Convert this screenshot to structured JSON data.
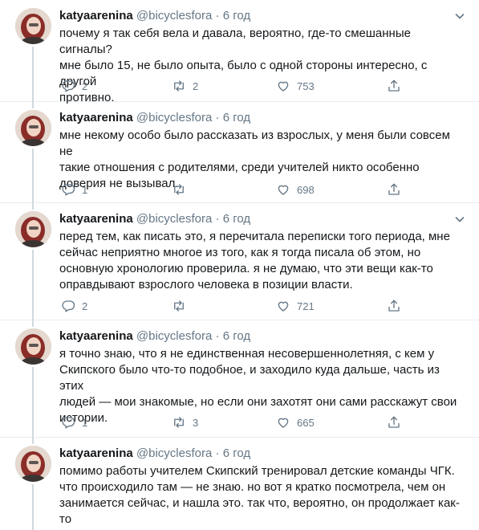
{
  "author": {
    "name": "katyaarenina",
    "handle": "@bicyclesfora",
    "separator": "·",
    "time": "6 год"
  },
  "icons": {
    "reply": "reply-icon",
    "retweet": "retweet-icon",
    "like": "heart-icon",
    "share": "share-icon",
    "menu": "chevron-down-icon"
  },
  "colors": {
    "text": "#14171a",
    "secondary": "#657786",
    "divider": "#e6ecf0",
    "thread_line": "#cfd9de"
  },
  "tweets": [
    {
      "text": "почему я так себя вела и давала, вероятно, где-то смешанные сигналы?\nмне было 15, не было опыта, было с одной стороны интересно, с другой\nпротивно.",
      "replies": "2",
      "retweets": "2",
      "likes": "753"
    },
    {
      "text": "мне некому особо было рассказать из взрослых, у меня были совсем не\nтакие отношения с родителями, среди учителей никто особенно\nдоверия не вызывал.",
      "replies": "1",
      "retweets": "",
      "likes": "698"
    },
    {
      "text": "перед тем, как писать это, я перечитала переписки того периода, мне\nсейчас неприятно многое из того, как я тогда писала об этом, но\nосновную хронологию проверила. я не думаю, что эти вещи как-то\nоправдывают взрослого человека в позиции власти.",
      "replies": "2",
      "retweets": "",
      "likes": "721"
    },
    {
      "text": "я точно знаю, что я не единственная несовершеннолетняя, с кем у\nСкипского было что-то подобное, и заходило куда дальше, часть из этих\nлюдей — мои знакомые, но если они захотят они сами расскажут свои\nистории.",
      "replies": "1",
      "retweets": "3",
      "likes": "665"
    },
    {
      "text": "помимо работы учителем Скипский тренировал детские команды ЧГК.\nчто происходило там — не знаю. но вот я кратко посмотрела, чем он\nзанимается сейчас, и нашла это. так что, вероятно, он продолжает как-то\nработать с детьми.",
      "replies": "",
      "retweets": "",
      "likes": ""
    }
  ]
}
